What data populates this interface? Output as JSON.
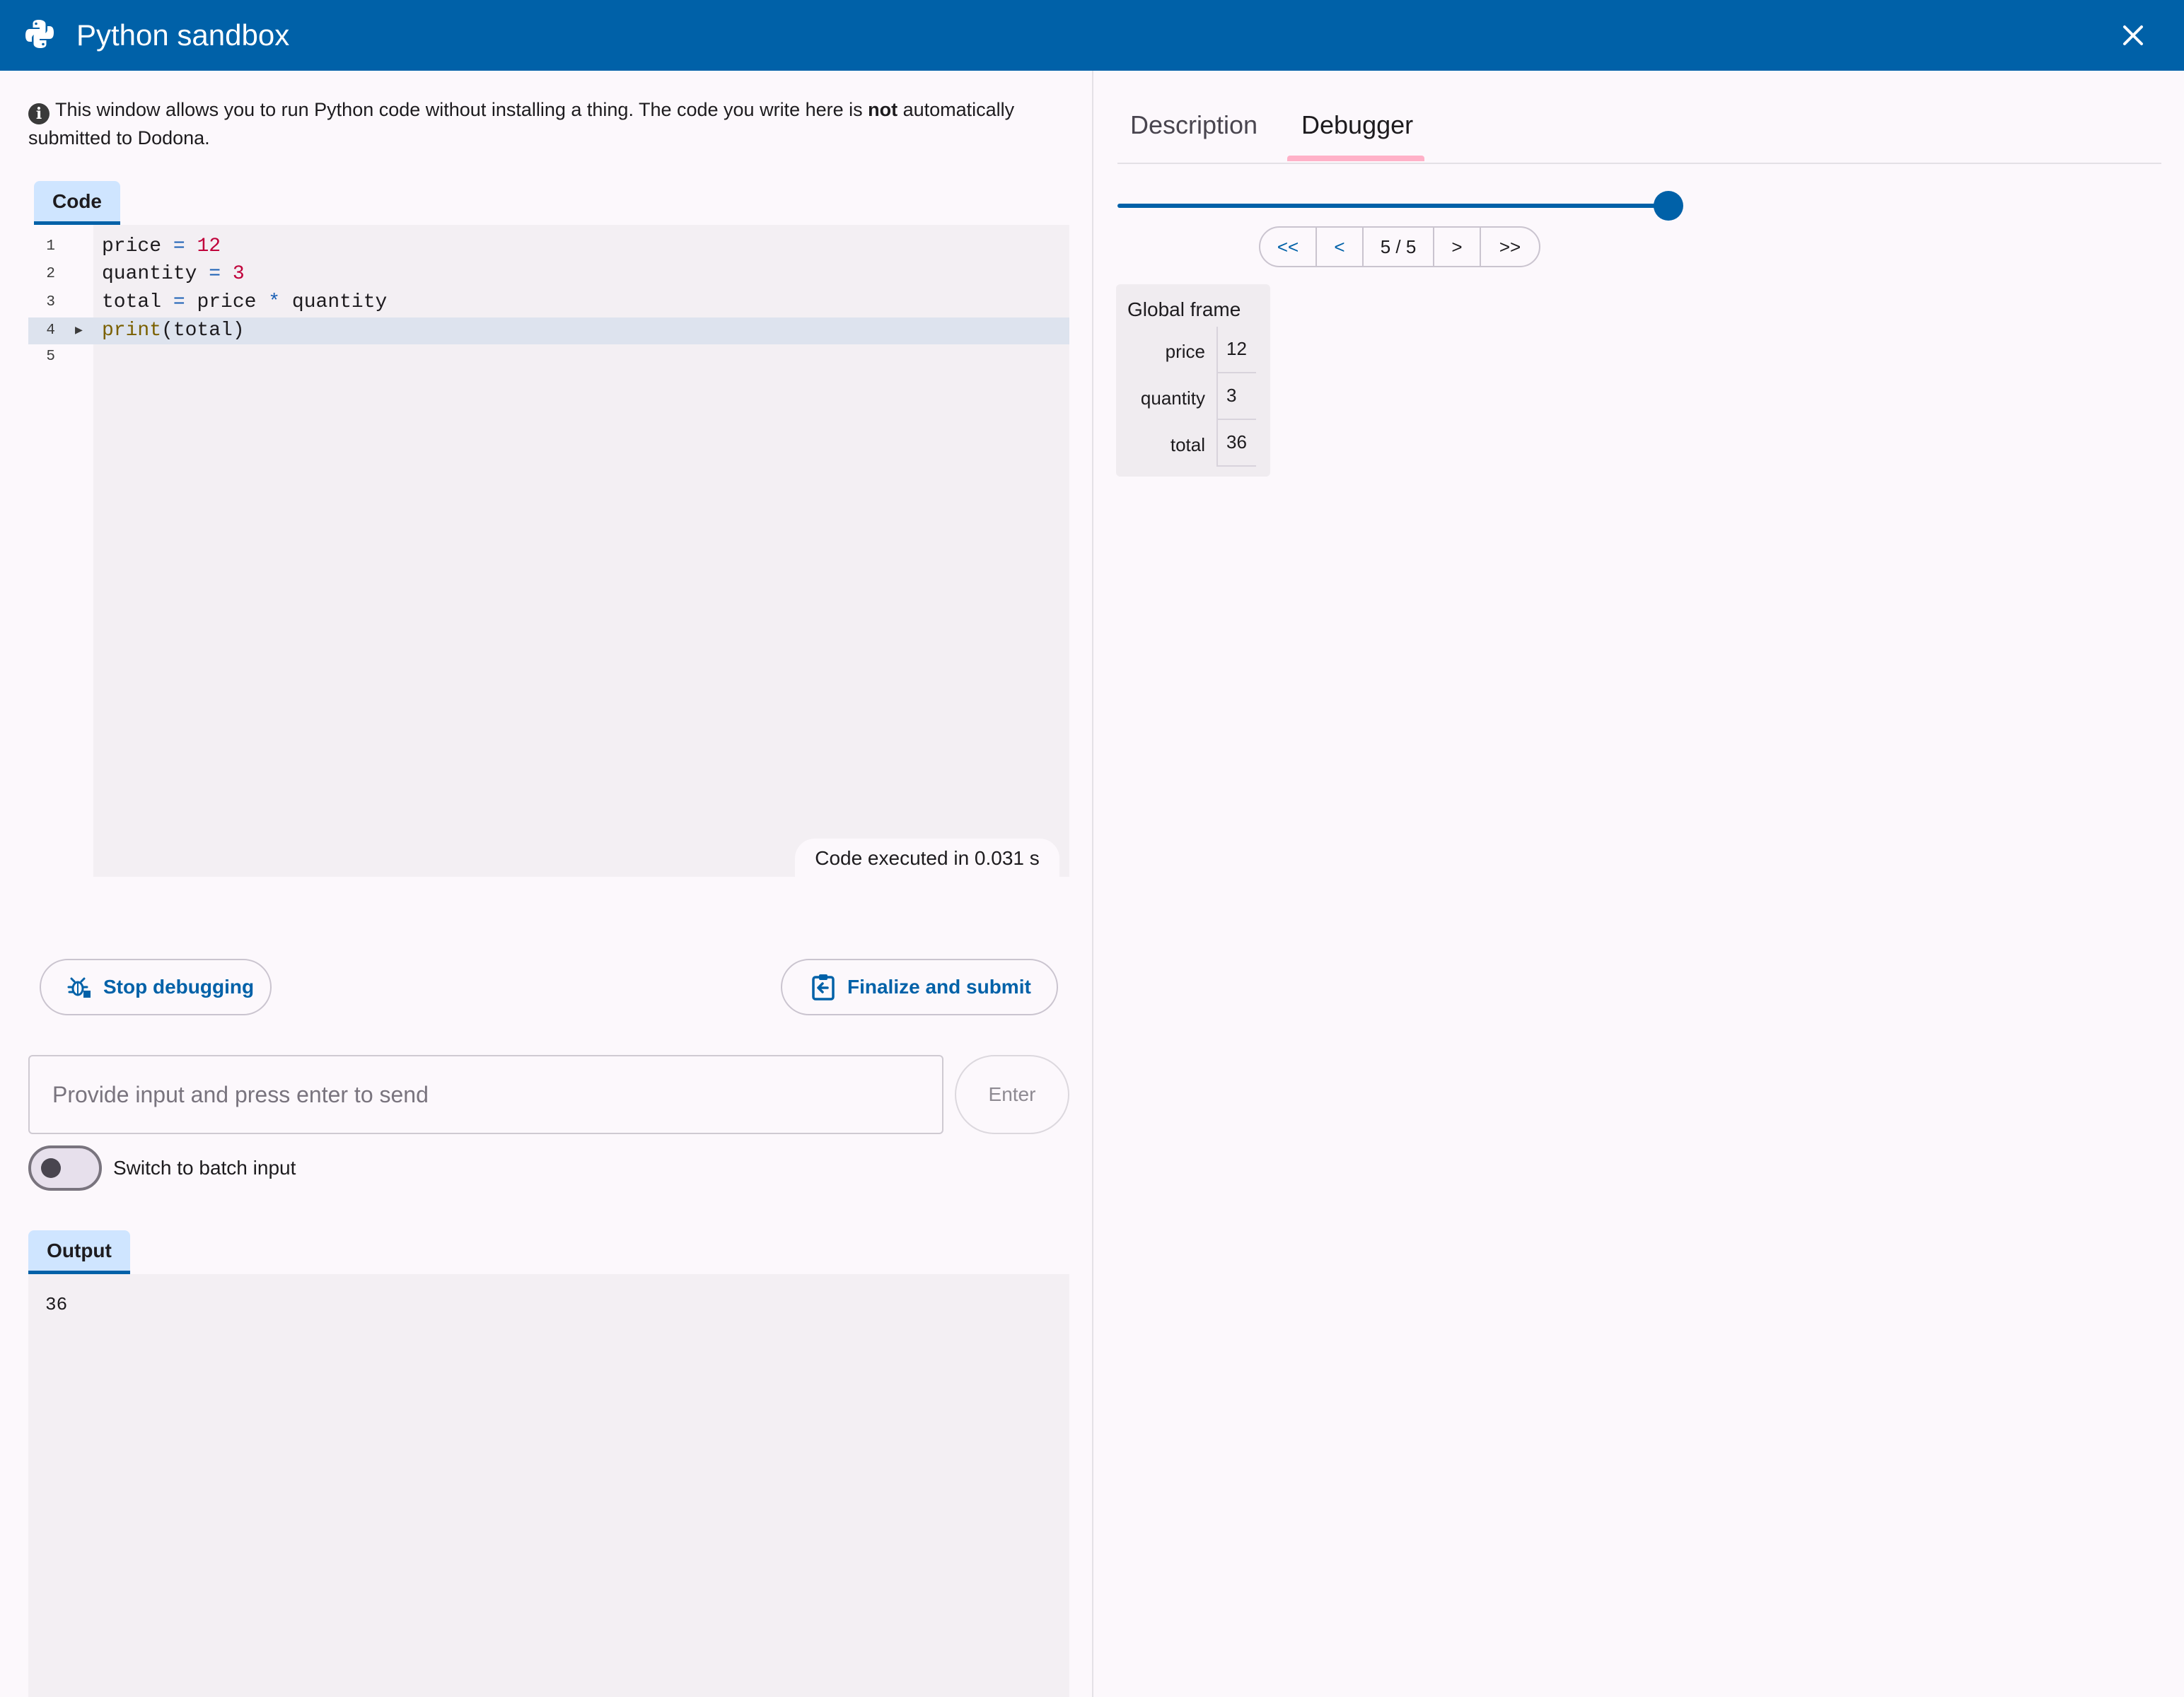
{
  "window": {
    "title": "Python sandbox",
    "icons": {
      "logo": "python-logo-icon",
      "close": "close-icon"
    }
  },
  "info": {
    "icon": "info-icon",
    "text_before": "This window allows you to run Python code without installing a thing. The code you write here is ",
    "bold": "not",
    "text_after": " automatically submitted to Dodona."
  },
  "editor": {
    "tab_label": "Code",
    "current_line": 4,
    "lines": [
      {
        "number": "1",
        "text": "price = 12"
      },
      {
        "number": "2",
        "text": "quantity = 3"
      },
      {
        "number": "3",
        "text": "total = price * quantity"
      },
      {
        "number": "4",
        "text": "print(total)"
      },
      {
        "number": "5",
        "text": ""
      }
    ],
    "execution_time": "Code executed in 0.031 s"
  },
  "actions": {
    "stop_label": "Stop debugging",
    "stop_icon": "bug-icon",
    "submit_label": "Finalize and submit",
    "submit_icon": "clipboard-submit-icon"
  },
  "input": {
    "placeholder": "Provide input and press enter to send",
    "enter_label": "Enter",
    "batch_toggle_label": "Switch to batch input",
    "batch_toggle_on": false
  },
  "output": {
    "tab_label": "Output",
    "text": "36"
  },
  "right_panel": {
    "tabs": [
      {
        "label": "Description",
        "active": false
      },
      {
        "label": "Debugger",
        "active": true
      }
    ],
    "debugger": {
      "step_current": 5,
      "step_total": 5,
      "step_label": "5 / 5",
      "controls": {
        "first": "<<",
        "prev": "<",
        "next": ">",
        "last": ">>"
      },
      "frame_title": "Global frame",
      "variables": [
        {
          "name": "price",
          "value": "12"
        },
        {
          "name": "quantity",
          "value": "3"
        },
        {
          "name": "total",
          "value": "36"
        }
      ]
    }
  },
  "colors": {
    "primary": "#0061a8",
    "tab_indicator": "#ffb1c8",
    "tab_background": "#cfe5ff",
    "editor_background": "#f3eff3"
  }
}
